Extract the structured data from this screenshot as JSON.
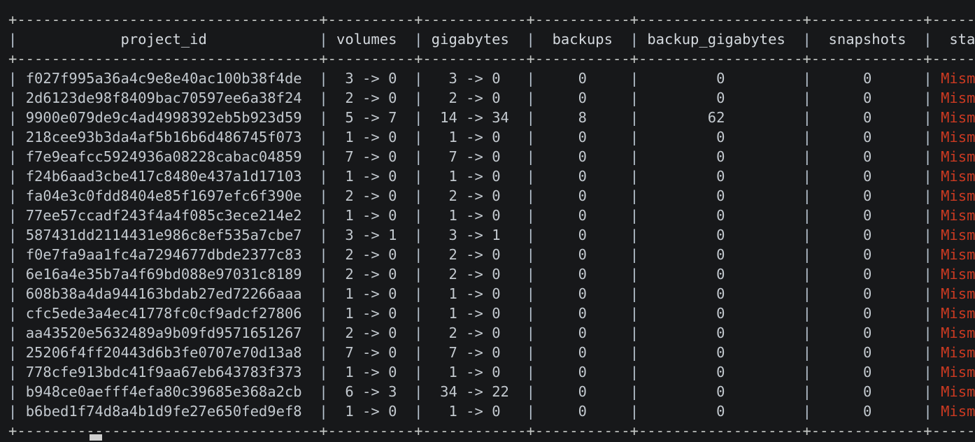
{
  "terminal": {
    "background_color": "#17181a",
    "foreground_color": "#c8cdd2",
    "mismatch_color": "#cc3a22",
    "cursor_color": "#cfcfcf"
  },
  "table": {
    "border_char_top": "+-----------------------------------+----------+------------+-----------+-------------------+-------------+----------+",
    "columns": [
      {
        "key": "project_id",
        "label": "project_id",
        "width": 35,
        "align": "center"
      },
      {
        "key": "volumes",
        "label": "volumes",
        "width": 10,
        "align": "center"
      },
      {
        "key": "gigabytes",
        "label": "gigabytes",
        "width": 12,
        "align": "center"
      },
      {
        "key": "backups",
        "label": "backups",
        "width": 11,
        "align": "center"
      },
      {
        "key": "backup_gigabytes",
        "label": "backup_gigabytes",
        "width": 19,
        "align": "center"
      },
      {
        "key": "snapshots",
        "label": "snapshots",
        "width": 13,
        "align": "center"
      },
      {
        "key": "status",
        "label": "status",
        "width": 10,
        "align": "center"
      }
    ],
    "rows": [
      {
        "project_id": "f027f995a36a4c9e8e40ac100b38f4de",
        "volumes": "3 -> 0",
        "gigabytes": "3 -> 0",
        "backups": "0",
        "backup_gigabytes": "0",
        "snapshots": "0",
        "status": "Mismatch"
      },
      {
        "project_id": "2d6123de98f8409bac70597ee6a38f24",
        "volumes": "2 -> 0",
        "gigabytes": "2 -> 0",
        "backups": "0",
        "backup_gigabytes": "0",
        "snapshots": "0",
        "status": "Mismatch"
      },
      {
        "project_id": "9900e079de9c4ad4998392eb5b923d59",
        "volumes": "5 -> 7",
        "gigabytes": "14 -> 34",
        "backups": "8",
        "backup_gigabytes": "62",
        "snapshots": "0",
        "status": "Mismatch"
      },
      {
        "project_id": "218cee93b3da4af5b16b6d486745f073",
        "volumes": "1 -> 0",
        "gigabytes": "1 -> 0",
        "backups": "0",
        "backup_gigabytes": "0",
        "snapshots": "0",
        "status": "Mismatch"
      },
      {
        "project_id": "f7e9eafcc5924936a08228cabac04859",
        "volumes": "7 -> 0",
        "gigabytes": "7 -> 0",
        "backups": "0",
        "backup_gigabytes": "0",
        "snapshots": "0",
        "status": "Mismatch"
      },
      {
        "project_id": "f24b6aad3cbe417c8480e437a1d17103",
        "volumes": "1 -> 0",
        "gigabytes": "1 -> 0",
        "backups": "0",
        "backup_gigabytes": "0",
        "snapshots": "0",
        "status": "Mismatch"
      },
      {
        "project_id": "fa04e3c0fdd8404e85f1697efc6f390e",
        "volumes": "2 -> 0",
        "gigabytes": "2 -> 0",
        "backups": "0",
        "backup_gigabytes": "0",
        "snapshots": "0",
        "status": "Mismatch"
      },
      {
        "project_id": "77ee57ccadf243f4a4f085c3ece214e2",
        "volumes": "1 -> 0",
        "gigabytes": "1 -> 0",
        "backups": "0",
        "backup_gigabytes": "0",
        "snapshots": "0",
        "status": "Mismatch"
      },
      {
        "project_id": "587431dd2114431e986c8ef535a7cbe7",
        "volumes": "3 -> 1",
        "gigabytes": "3 -> 1",
        "backups": "0",
        "backup_gigabytes": "0",
        "snapshots": "0",
        "status": "Mismatch"
      },
      {
        "project_id": "f0e7fa9aa1fc4a7294677dbde2377c83",
        "volumes": "2 -> 0",
        "gigabytes": "2 -> 0",
        "backups": "0",
        "backup_gigabytes": "0",
        "snapshots": "0",
        "status": "Mismatch"
      },
      {
        "project_id": "6e16a4e35b7a4f69bd088e97031c8189",
        "volumes": "2 -> 0",
        "gigabytes": "2 -> 0",
        "backups": "0",
        "backup_gigabytes": "0",
        "snapshots": "0",
        "status": "Mismatch"
      },
      {
        "project_id": "608b38a4da944163bdab27ed72266aaa",
        "volumes": "1 -> 0",
        "gigabytes": "1 -> 0",
        "backups": "0",
        "backup_gigabytes": "0",
        "snapshots": "0",
        "status": "Mismatch"
      },
      {
        "project_id": "cfc5ede3a4ec41778fc0cf9adcf27806",
        "volumes": "1 -> 0",
        "gigabytes": "1 -> 0",
        "backups": "0",
        "backup_gigabytes": "0",
        "snapshots": "0",
        "status": "Mismatch"
      },
      {
        "project_id": "aa43520e5632489a9b09fd9571651267",
        "volumes": "2 -> 0",
        "gigabytes": "2 -> 0",
        "backups": "0",
        "backup_gigabytes": "0",
        "snapshots": "0",
        "status": "Mismatch"
      },
      {
        "project_id": "25206f4ff20443d6b3fe0707e70d13a8",
        "volumes": "7 -> 0",
        "gigabytes": "7 -> 0",
        "backups": "0",
        "backup_gigabytes": "0",
        "snapshots": "0",
        "status": "Mismatch"
      },
      {
        "project_id": "778cfe913bdc41f9aa67eb643783f373",
        "volumes": "1 -> 0",
        "gigabytes": "1 -> 0",
        "backups": "0",
        "backup_gigabytes": "0",
        "snapshots": "0",
        "status": "Mismatch"
      },
      {
        "project_id": "b948ce0aefff4efa80c39685e368a2cb",
        "volumes": "6 -> 3",
        "gigabytes": "34 -> 22",
        "backups": "0",
        "backup_gigabytes": "0",
        "snapshots": "0",
        "status": "Mismatch"
      },
      {
        "project_id": "b6bed1f74d8a4b1d9fe27e650fed9ef8",
        "volumes": "1 -> 0",
        "gigabytes": "1 -> 0",
        "backups": "0",
        "backup_gigabytes": "0",
        "snapshots": "0",
        "status": "Mismatch"
      }
    ]
  }
}
